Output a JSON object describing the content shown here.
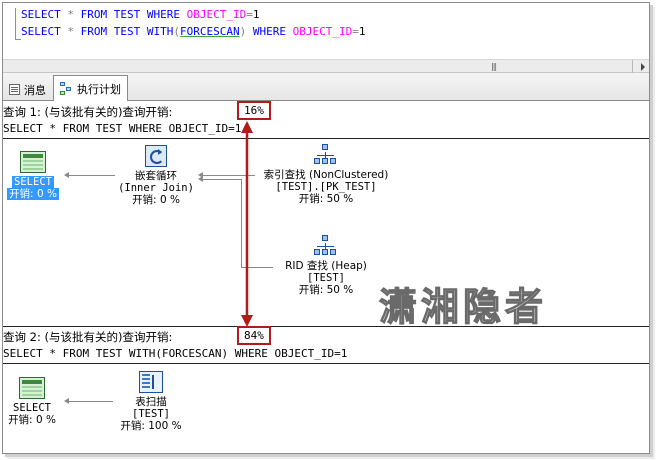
{
  "editor": {
    "line1": {
      "select": "SELECT",
      "star": "*",
      "from": "FROM",
      "table": "TEST",
      "where": "WHERE",
      "col": "OBJECT_ID",
      "eq": "=",
      "val": "1"
    },
    "line2": {
      "select": "SELECT",
      "star": "*",
      "from": "FROM",
      "table": "TEST",
      "with": "WITH",
      "lparen": "(",
      "hint": "FORCESCAN",
      "rparen": ")",
      "where": "WHERE",
      "col": "OBJECT_ID",
      "eq": "=",
      "val": "1"
    }
  },
  "scrollbar": {
    "grip": "|||"
  },
  "tabs": [
    {
      "label": "消息",
      "icon": "message-icon"
    },
    {
      "label": "执行计划",
      "icon": "execution-plan-icon",
      "active": true
    }
  ],
  "queries": [
    {
      "header": "查询 1: (与该批有关的)查询开销:",
      "cost": "16%",
      "sql": "SELECT * FROM TEST WHERE OBJECT_ID=1",
      "nodes": {
        "select": {
          "name": "SELECT",
          "cost": "开销: 0 %"
        },
        "loop": {
          "name": "嵌套循环",
          "sub": "(Inner Join)",
          "cost": "开销: 0 %"
        },
        "seek": {
          "name": "索引查找 (NonClustered)",
          "sub": "[TEST].[PK_TEST]",
          "cost": "开销: 50 %"
        },
        "rid": {
          "name": "RID 查找 (Heap)",
          "sub": "[TEST]",
          "cost": "开销: 50 %"
        }
      }
    },
    {
      "header": "查询 2: (与该批有关的)查询开销:",
      "cost": "84%",
      "sql": "SELECT * FROM TEST WITH(FORCESCAN) WHERE OBJECT_ID=1",
      "nodes": {
        "select": {
          "name": "SELECT",
          "cost": "开销: 0 %"
        },
        "scan": {
          "name": "表扫描",
          "sub": "[TEST]",
          "cost": "开销: 100 %"
        }
      }
    }
  ],
  "watermark": "潇湘隐者",
  "colors": {
    "highlight": "#b01c1c",
    "selection": "#3399ff",
    "keyword": "#0000ff",
    "function": "#ff00ff"
  }
}
